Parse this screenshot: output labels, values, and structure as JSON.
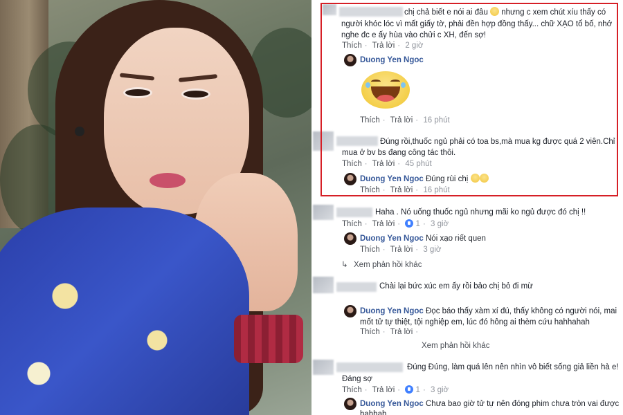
{
  "thread": {
    "actions": {
      "like": "Thích",
      "reply": "Trả lời"
    },
    "view_more": "Xem phản hồi khác",
    "comments": [
      {
        "text_line1": "chị chả biết e nói ai đâu",
        "text_line1b": "nhưng c xem chút xíu thấy có",
        "text_line2": "người khóc lóc vì mất giấy tờ, phải đền hợp đồng thấy... chữ XẠO tổ bố, nhớ",
        "text_line3": "nghe đc e ấy hùa vào chửi c XH, đến sợ!",
        "time": "2 giờ",
        "reply": {
          "author": "Duong Yen Ngoc",
          "time": "16 phút"
        }
      },
      {
        "text_line1": "Đúng rồi,thuốc ngủ phải có toa bs,mà mua kg được quá 2 viên.Chỉ",
        "text_line2": "mua ở bv bs đang công tác thôi.",
        "time": "45 phút",
        "reply": {
          "author": "Duong Yen Ngoc",
          "text": "Đúng rùi chị",
          "time": "16 phút"
        }
      },
      {
        "text_line1": "Haha . Nó uống thuốc ngủ nhưng mãi ko ngủ được đó chị !!",
        "likes": "1",
        "time": "3 giờ",
        "reply": {
          "author": "Duong Yen Ngoc",
          "text": "Nói xạo riết quen",
          "time": "3 giờ"
        }
      },
      {
        "text_line1": "Chài lại bức xúc em ấy rồi bảo chị bỏ đi mừ",
        "reply": {
          "author": "Duong Yen Ngoc",
          "text_line1": "Đọc báo thấy xàm xí đú, thấy không có người nói, mai",
          "text_line2": "mốt tử tự thiệt, tội nghiệp em, lúc đó hông ai thèm cứu hahhahah"
        }
      },
      {
        "text_line1": "Đúng Đúng, làm quá lên nên nhìn vô biết sống giả liền hà e!",
        "text_line2": "Đáng sợ",
        "likes": "1",
        "time": "3 giờ",
        "reply": {
          "author": "Duong Yen Ngoc",
          "text_line1": "Chưa bao giờ tử tự nên đóng phim chưa tròn vai được",
          "text_line2": "hahhah"
        }
      }
    ]
  },
  "colors": {
    "highlight_border": "#d61f26",
    "name": "#365899",
    "meta": "#90949c"
  }
}
